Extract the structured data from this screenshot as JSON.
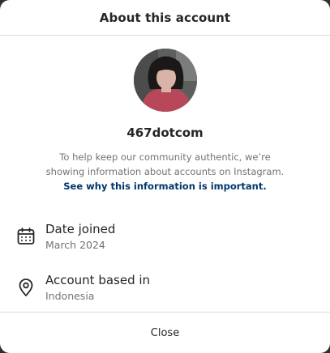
{
  "dialog": {
    "title": "About this account",
    "close_label": "Close"
  },
  "profile": {
    "username": "467dotcom",
    "info_text": "To help keep our community authentic, we’re showing information about accounts on Instagram.",
    "info_link": "See why this information is important."
  },
  "details": {
    "date_joined": {
      "label": "Date joined",
      "value": "March 2024",
      "icon": "calendar-icon"
    },
    "account_based_in": {
      "label": "Account based in",
      "value": "Indonesia",
      "icon": "location-pin-icon"
    }
  },
  "colors": {
    "primary_text": "#262626",
    "secondary_text": "#737373",
    "link": "#00376b",
    "divider": "#dbdbdb"
  }
}
